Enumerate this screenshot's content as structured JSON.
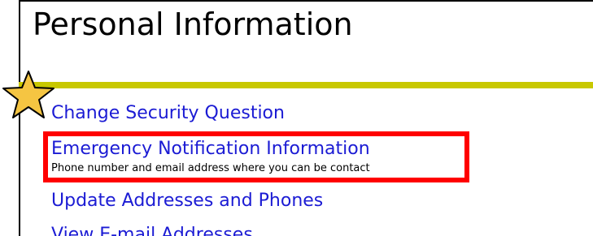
{
  "page": {
    "title": "Personal Information"
  },
  "menu": {
    "items": [
      {
        "label": "Change Security Question"
      },
      {
        "label": "Emergency Notification Information",
        "description": "Phone number and email address where you can be contact"
      },
      {
        "label": "Update Addresses and Phones"
      },
      {
        "label": "View E-mail Addresses"
      }
    ]
  },
  "annotation": {
    "star_color": "#f5c542",
    "highlight_color": "#ff0000"
  },
  "colors": {
    "link": "#1b1bd4",
    "accent_bar": "#c8c800"
  }
}
